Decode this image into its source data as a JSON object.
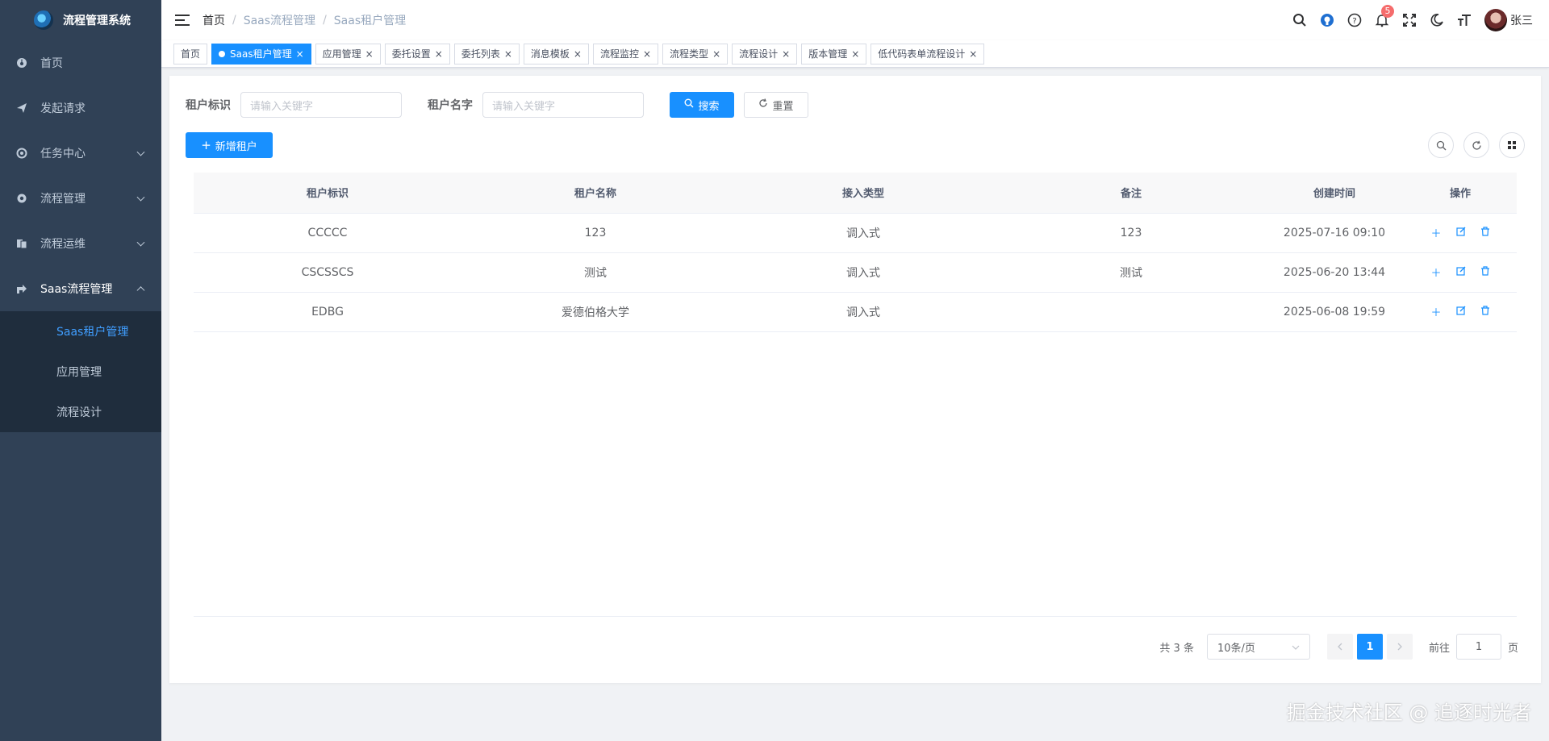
{
  "app": {
    "title": "流程管理系统"
  },
  "sidebar": {
    "items": [
      {
        "label": "首页",
        "icon": "dashboard-icon"
      },
      {
        "label": "发起请求",
        "icon": "send-icon"
      },
      {
        "label": "任务中心",
        "icon": "target-icon"
      },
      {
        "label": "流程管理",
        "icon": "gear-icon"
      },
      {
        "label": "流程运维",
        "icon": "documents-icon"
      },
      {
        "label": "Saas流程管理",
        "icon": "share-icon"
      }
    ],
    "sub_items": [
      {
        "label": "Saas租户管理"
      },
      {
        "label": "应用管理"
      },
      {
        "label": "流程设计"
      }
    ]
  },
  "breadcrumb": [
    "首页",
    "Saas流程管理",
    "Saas租户管理"
  ],
  "notifications": {
    "count": "5"
  },
  "user": {
    "name": "张三"
  },
  "tags": [
    "首页",
    "Saas租户管理",
    "应用管理",
    "委托设置",
    "委托列表",
    "消息模板",
    "流程监控",
    "流程类型",
    "流程设计",
    "版本管理",
    "低代码表单流程设计"
  ],
  "search": {
    "tenant_id_label": "租户标识",
    "tenant_id_placeholder": "请输入关键字",
    "tenant_name_label": "租户名字",
    "tenant_name_placeholder": "请输入关键字",
    "search_button": "搜索",
    "reset_button": "重置"
  },
  "toolbar": {
    "add_button": "新增租户"
  },
  "table": {
    "headers": [
      "租户标识",
      "租户名称",
      "接入类型",
      "备注",
      "创建时间",
      "操作"
    ],
    "rows": [
      [
        "CCCCC",
        "123",
        "调入式",
        "123",
        "2025-07-16 09:10"
      ],
      [
        "CSCSSCS",
        "测试",
        "调入式",
        "测试",
        "2025-06-20 13:44"
      ],
      [
        "EDBG",
        "爱德伯格大学",
        "调入式",
        "",
        "2025-06-08 19:59"
      ]
    ]
  },
  "pagination": {
    "total": "共 3 条",
    "page_size": "10条/页",
    "current_page": "1",
    "goto_label": "前往",
    "goto_value": "1",
    "page_suffix": "页"
  },
  "watermark": "掘金技术社区 @ 追逐时光者",
  "colors": {
    "primary": "#1890ff",
    "sidebar_bg": "#304156",
    "submenu_bg": "#1f2d3d",
    "badge": "#f56c6c"
  }
}
